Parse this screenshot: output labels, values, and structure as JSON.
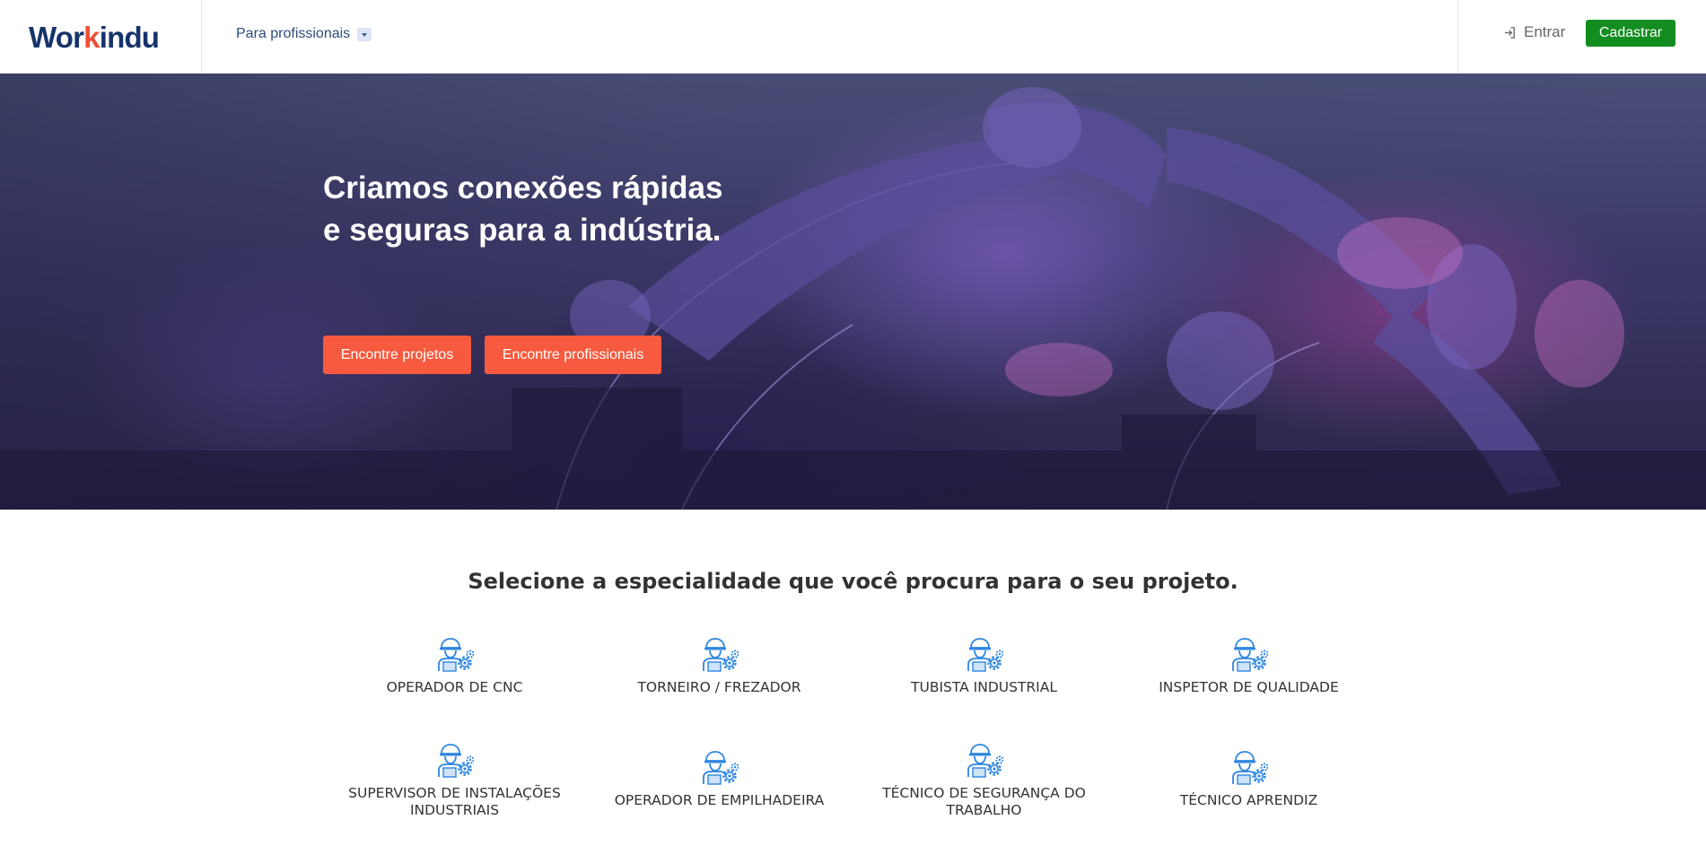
{
  "header": {
    "logo_text_before": "Wor",
    "logo_text_accent": "k",
    "logo_text_after": "indu",
    "nav_dropdown_label": "Para profissionais",
    "login_label": "Entrar",
    "signup_label": "Cadastrar"
  },
  "hero": {
    "title_line1": "Criamos conexões rápidas",
    "title_line2": "e seguras para a indústria.",
    "find_projects_label": "Encontre projetos",
    "find_professionals_label": "Encontre profissionais"
  },
  "specialties": {
    "title": "Selecione a especialidade que você procura para o seu projeto.",
    "items": [
      {
        "label_line1": "OPERADOR DE CNC",
        "label_line2": ""
      },
      {
        "label_line1": "TORNEIRO / FREZADOR",
        "label_line2": ""
      },
      {
        "label_line1": "TUBISTA INDUSTRIAL",
        "label_line2": ""
      },
      {
        "label_line1": "INSPETOR DE QUALIDADE",
        "label_line2": ""
      },
      {
        "label_line1": "SUPERVISOR DE INSTALAÇÕES",
        "label_line2": "INDUSTRIAIS"
      },
      {
        "label_line1": "OPERADOR DE EMPILHADEIRA",
        "label_line2": ""
      },
      {
        "label_line1": "TÉCNICO DE SEGURANÇA DO",
        "label_line2": "TRABALHO"
      },
      {
        "label_line1": "TÉCNICO APRENDIZ",
        "label_line2": ""
      }
    ]
  },
  "colors": {
    "brand_navy": "#16336b",
    "brand_accent": "#f04e37",
    "cta_orange": "#f75a3e",
    "signup_green": "#138d1f",
    "icon_blue": "#2f86e0"
  },
  "icons": {
    "login": "login-arrow-icon",
    "dropdown": "chevron-down-icon",
    "specialty": "worker-gear-icon"
  }
}
